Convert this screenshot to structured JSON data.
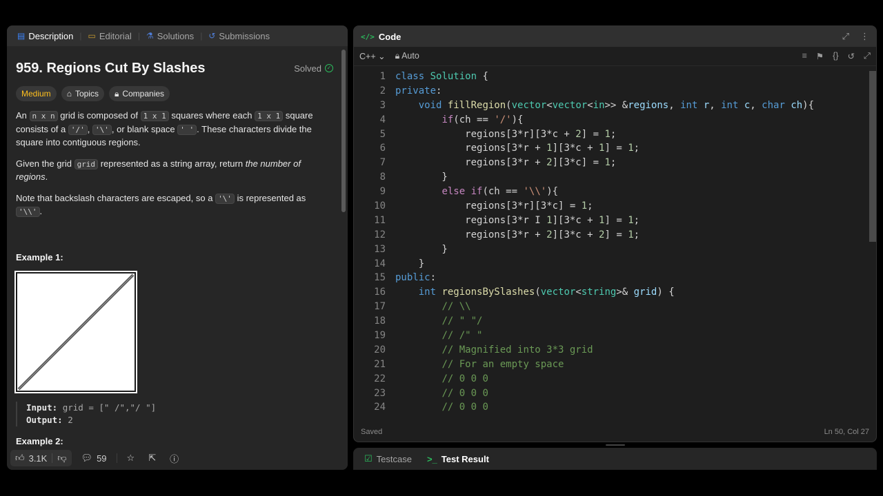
{
  "left_tabs": [
    {
      "label": "Description",
      "icon": "description-icon"
    },
    {
      "label": "Editorial",
      "icon": "book-icon"
    },
    {
      "label": "Solutions",
      "icon": "flask-icon"
    },
    {
      "label": "Submissions",
      "icon": "history-icon"
    }
  ],
  "problem": {
    "title": "959. Regions Cut By Slashes",
    "status": "Solved",
    "difficulty": "Medium",
    "topics_label": "Topics",
    "companies_label": "Companies"
  },
  "desc": {
    "p1_a": "An",
    "p1_code1": "n x n",
    "p1_b": "grid is composed of",
    "p1_code2": "1 x 1",
    "p1_c": "squares where each",
    "p1_code3": "1 x 1",
    "p1_d": "square consists of a",
    "p1_code4": "'/'",
    "p1_e": ",",
    "p1_code5": "'\\'",
    "p1_f": ", or blank space",
    "p1_code6": "' '",
    "p1_g": ". These characters divide the square into contiguous regions.",
    "p2_a": "Given the grid",
    "p2_code": "grid",
    "p2_b": "represented as a string array, return",
    "p2_em": "the number of regions",
    "p2_c": ".",
    "p3_a": "Note that backslash characters are escaped, so a",
    "p3_code1": "'\\'",
    "p3_b": "is represented as",
    "p3_code2": "'\\\\'",
    "p3_c": "."
  },
  "example1": {
    "title": "Example 1:",
    "input_label": "Input:",
    "input_value": "grid = [\" /\",\"/ \"]",
    "output_label": "Output:",
    "output_value": "2"
  },
  "example2": {
    "title": "Example 2:"
  },
  "bottom": {
    "likes": "3.1K",
    "comments": "59"
  },
  "code_panel": {
    "title": "Code",
    "language": "C++",
    "mode": "Auto",
    "status_left": "Saved",
    "status_right": "Ln 50, Col 27"
  },
  "code_lines": [
    {
      "n": "1"
    },
    {
      "n": "2"
    },
    {
      "n": "3"
    },
    {
      "n": "4"
    },
    {
      "n": "5"
    },
    {
      "n": "6"
    },
    {
      "n": "7"
    },
    {
      "n": "8"
    },
    {
      "n": "9"
    },
    {
      "n": "10"
    },
    {
      "n": "11"
    },
    {
      "n": "12"
    },
    {
      "n": "13"
    },
    {
      "n": "14"
    },
    {
      "n": "15"
    },
    {
      "n": "16"
    },
    {
      "n": "17"
    },
    {
      "n": "18"
    },
    {
      "n": "19"
    },
    {
      "n": "20"
    },
    {
      "n": "21"
    },
    {
      "n": "22"
    },
    {
      "n": "23"
    },
    {
      "n": "24"
    }
  ],
  "code": {
    "l1": [
      [
        "kw2",
        "class"
      ],
      [
        "",
        " "
      ],
      [
        "ty",
        "Solution"
      ],
      [
        "",
        " {"
      ]
    ],
    "l2": [
      [
        "kw2",
        "private"
      ],
      [
        "",
        ":"
      ]
    ],
    "l3": [
      [
        "",
        "    "
      ],
      [
        "kw2",
        "void"
      ],
      [
        "",
        " "
      ],
      [
        "fn",
        "fillRegion"
      ],
      [
        "",
        "("
      ],
      [
        "ty",
        "vector"
      ],
      [
        "",
        "<"
      ],
      [
        "ty",
        "vector"
      ],
      [
        "",
        "<"
      ],
      [
        "ty",
        "in"
      ],
      [
        "",
        ">>"
      ],
      [
        "",
        " &"
      ],
      [
        "va",
        "regions"
      ],
      [
        "",
        ", "
      ],
      [
        "kw2",
        "int"
      ],
      [
        "",
        " "
      ],
      [
        "va",
        "r"
      ],
      [
        "",
        ", "
      ],
      [
        "kw2",
        "int"
      ],
      [
        "",
        " "
      ],
      [
        "va",
        "c"
      ],
      [
        "",
        ", "
      ],
      [
        "kw2",
        "char"
      ],
      [
        "",
        " "
      ],
      [
        "va",
        "ch"
      ],
      [
        "",
        "){"
      ]
    ],
    "l4": [
      [
        "",
        "        "
      ],
      [
        "kw",
        "if"
      ],
      [
        "",
        "(ch == "
      ],
      [
        "st",
        "'/'"
      ],
      [
        "",
        "){"
      ]
    ],
    "l5": [
      [
        "",
        "            regions[3*r][3*c + "
      ],
      [
        "nu",
        "2"
      ],
      [
        "",
        "] = "
      ],
      [
        "nu",
        "1"
      ],
      [
        "",
        ";"
      ]
    ],
    "l6": [
      [
        "",
        "            regions[3*r + "
      ],
      [
        "nu",
        "1"
      ],
      [
        "",
        "][3*c + "
      ],
      [
        "nu",
        "1"
      ],
      [
        "",
        "] = "
      ],
      [
        "nu",
        "1"
      ],
      [
        "",
        ";"
      ]
    ],
    "l7": [
      [
        "",
        "            regions[3*r + "
      ],
      [
        "nu",
        "2"
      ],
      [
        "",
        "][3*c] = "
      ],
      [
        "nu",
        "1"
      ],
      [
        "",
        ";"
      ]
    ],
    "l8": [
      [
        "",
        "        }"
      ]
    ],
    "l9": [
      [
        "",
        "        "
      ],
      [
        "kw",
        "else if"
      ],
      [
        "",
        "(ch == "
      ],
      [
        "st",
        "'\\\\'"
      ],
      [
        "",
        "){"
      ]
    ],
    "l10": [
      [
        "",
        "            regions[3*r][3*c] = "
      ],
      [
        "nu",
        "1"
      ],
      [
        "",
        ";"
      ]
    ],
    "l11": [
      [
        "",
        "            regions[3*r "
      ],
      [
        "",
        "I"
      ],
      [
        "",
        " "
      ],
      [
        "nu",
        "1"
      ],
      [
        "",
        "][3*c + "
      ],
      [
        "nu",
        "1"
      ],
      [
        "",
        "] = "
      ],
      [
        "nu",
        "1"
      ],
      [
        "",
        ";"
      ]
    ],
    "l12": [
      [
        "",
        "            regions[3*r + "
      ],
      [
        "nu",
        "2"
      ],
      [
        "",
        "][3*c + "
      ],
      [
        "nu",
        "2"
      ],
      [
        "",
        "] = "
      ],
      [
        "nu",
        "1"
      ],
      [
        "",
        ";"
      ]
    ],
    "l13": [
      [
        "",
        "        }"
      ]
    ],
    "l14": [
      [
        "",
        "    }"
      ]
    ],
    "l15": [
      [
        "kw2",
        "public"
      ],
      [
        "",
        ":"
      ]
    ],
    "l16": [
      [
        "",
        "    "
      ],
      [
        "kw2",
        "int"
      ],
      [
        "",
        " "
      ],
      [
        "fn",
        "regionsBySlashes"
      ],
      [
        "",
        "("
      ],
      [
        "ty",
        "vector"
      ],
      [
        "",
        "<"
      ],
      [
        "ty",
        "string"
      ],
      [
        "",
        ">& "
      ],
      [
        "va",
        "grid"
      ],
      [
        "",
        ") {"
      ]
    ],
    "l17": [
      [
        "",
        "        "
      ],
      [
        "cm",
        "// \\\\"
      ]
    ],
    "l18": [
      [
        "",
        "        "
      ],
      [
        "cm",
        "// \" \"/"
      ]
    ],
    "l19": [
      [
        "",
        "        "
      ],
      [
        "cm",
        "// /\" \""
      ]
    ],
    "l20": [
      [
        "",
        "        "
      ],
      [
        "cm",
        "// Magnified into 3*3 grid"
      ]
    ],
    "l21": [
      [
        "",
        "        "
      ],
      [
        "cm",
        "// For an empty space"
      ]
    ],
    "l22": [
      [
        "",
        "        "
      ],
      [
        "cm",
        "// 0 0 0"
      ]
    ],
    "l23": [
      [
        "",
        "        "
      ],
      [
        "cm",
        "// 0 0 0"
      ]
    ],
    "l24": [
      [
        "",
        "        "
      ],
      [
        "cm",
        "// 0 0 0"
      ]
    ]
  },
  "test_tabs": [
    {
      "label": "Testcase"
    },
    {
      "label": "Test Result"
    }
  ]
}
